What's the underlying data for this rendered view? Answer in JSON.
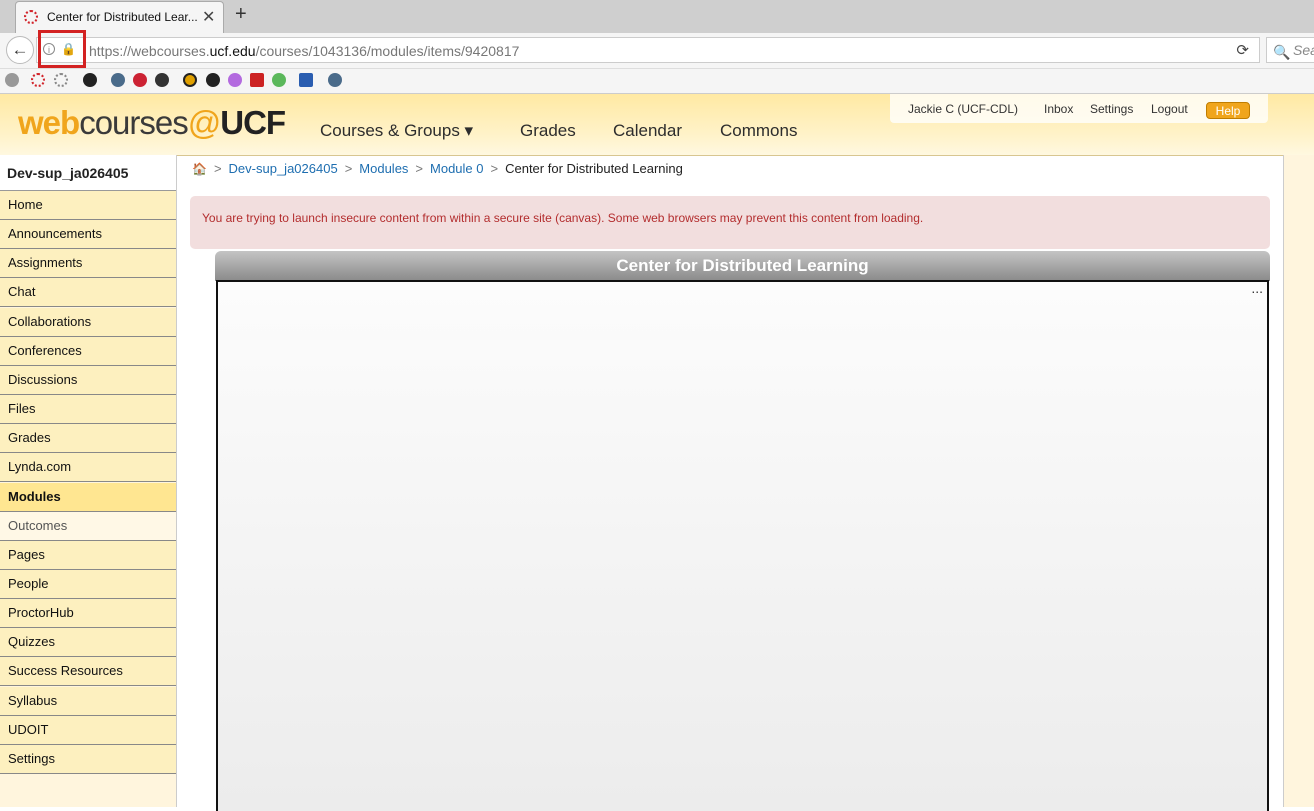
{
  "browser": {
    "tab_title": "Center for Distributed Lear...",
    "close_glyph": "✕",
    "newtab_glyph": "+",
    "url_prefix": "https://webcourses.",
    "url_domain": "ucf.edu",
    "url_path": "/courses/1043136/modules/items/9420817",
    "search_placeholder": "Sea",
    "back_glyph": "←",
    "reload_glyph": "⟳",
    "info_glyph": "i",
    "lock_glyph": "🔒",
    "search_glyph": "🔍"
  },
  "header": {
    "logo": {
      "web": "web",
      "courses": "courses",
      "at": "@",
      "ucf": "UCF"
    },
    "nav": {
      "courses_groups": "Courses & Groups ▾",
      "grades": "Grades",
      "calendar": "Calendar",
      "commons": "Commons"
    },
    "user": {
      "name": "Jackie C (UCF-CDL)",
      "inbox": "Inbox",
      "settings": "Settings",
      "logout": "Logout",
      "help": "Help"
    }
  },
  "sidebar": {
    "course_name": "Dev-sup_ja026405",
    "items": [
      {
        "label": "Home"
      },
      {
        "label": "Announcements"
      },
      {
        "label": "Assignments"
      },
      {
        "label": "Chat"
      },
      {
        "label": "Collaborations"
      },
      {
        "label": "Conferences"
      },
      {
        "label": "Discussions"
      },
      {
        "label": "Files"
      },
      {
        "label": "Grades"
      },
      {
        "label": "Lynda.com"
      },
      {
        "label": "Modules"
      },
      {
        "label": "Outcomes"
      },
      {
        "label": "Pages"
      },
      {
        "label": "People"
      },
      {
        "label": "ProctorHub"
      },
      {
        "label": "Quizzes"
      },
      {
        "label": "Success Resources"
      },
      {
        "label": "Syllabus"
      },
      {
        "label": "UDOIT"
      },
      {
        "label": "Settings"
      }
    ],
    "active": "Modules",
    "muted": "Outcomes"
  },
  "breadcrumb": {
    "home_glyph": "🏠",
    "sep": ">",
    "course": "Dev-sup_ja026405",
    "modules": "Modules",
    "module0": "Module 0",
    "current": "Center for Distributed Learning"
  },
  "alert": {
    "text": "You are trying to launch insecure content from within a secure site (canvas). Some web browsers may prevent this content from loading."
  },
  "frame": {
    "title": "Center for Distributed Learning",
    "ellipsis": "..."
  },
  "colors": {
    "accent": "#f0a51c",
    "link": "#1e6eb0",
    "alert_text": "#b32d2e",
    "alert_bg": "#f2dede"
  }
}
